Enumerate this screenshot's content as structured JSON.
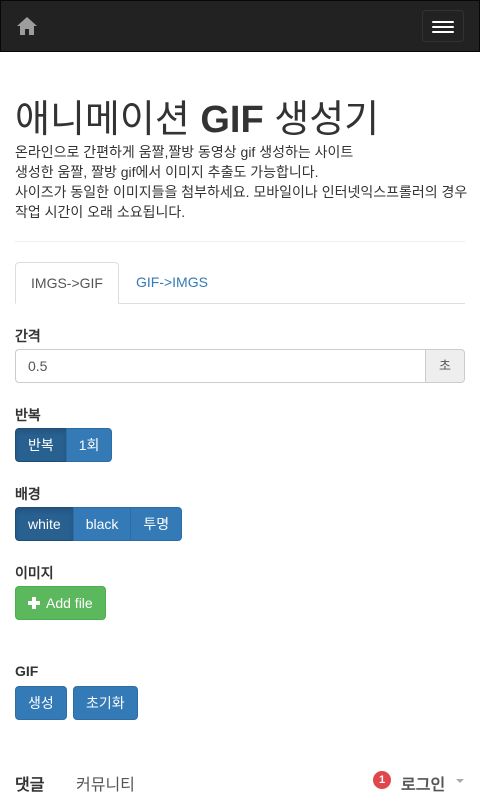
{
  "navbar": {
    "home_icon": "home-icon",
    "menu_icon": "hamburger-menu-icon"
  },
  "page": {
    "title_prefix": "애니메이션 ",
    "title_strong": "GIF",
    "title_suffix": " 생성기",
    "description": [
      "온라인으로 간편하게 움짤,짤방 동영상 gif 생성하는 사이트",
      "생성한 움짤, 짤방 gif에서 이미지 추출도 가능합니다.",
      "사이즈가 동일한 이미지들을 첨부하세요. 모바일이나 인터넷익스프롤러의 경우 작업 시간이 오래 소요됩니다."
    ]
  },
  "tabs": [
    {
      "label": "IMGS->GIF",
      "active": true
    },
    {
      "label": "GIF->IMGS",
      "active": false
    }
  ],
  "interval": {
    "label": "간격",
    "value": "0.5",
    "unit": "초"
  },
  "repeat": {
    "label": "반복",
    "options": [
      "반복",
      "1회"
    ],
    "selected": "반복"
  },
  "background": {
    "label": "배경",
    "options": [
      "white",
      "black",
      "투명"
    ],
    "selected": "white"
  },
  "image": {
    "label": "이미지",
    "add_file": "Add file",
    "add_icon": "plus-icon"
  },
  "gif": {
    "label": "GIF",
    "generate": "생성",
    "reset": "초기화"
  },
  "comments": {
    "tab_comments": "댓글",
    "tab_community": "커뮤니티",
    "notification_count": "1",
    "login": "로그인"
  },
  "colors": {
    "primary": "#337ab7",
    "primary_active": "#286090",
    "success": "#5cb85c",
    "navbar": "#222222",
    "badge": "#e0474c"
  }
}
